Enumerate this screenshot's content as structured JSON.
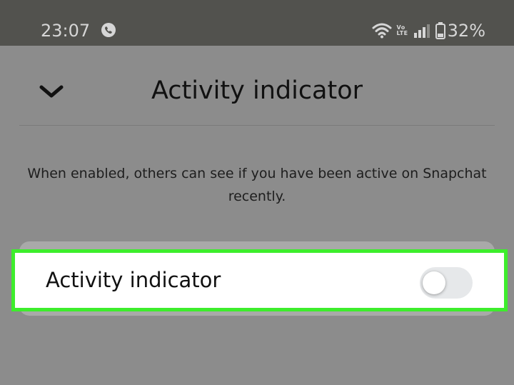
{
  "status_bar": {
    "time": "23:07",
    "call_icon": "phone-call-icon",
    "wifi_icon": "wifi-icon",
    "volte_top": "Vo",
    "volte_bottom": "LTE",
    "signal_icon": "signal-bars-icon",
    "battery_icon": "battery-icon",
    "battery_percent": "32%"
  },
  "header": {
    "back_icon": "chevron-down-icon",
    "title": "Activity indicator"
  },
  "description": "When enabled, others can see if you have been active on Snapchat recently.",
  "setting": {
    "label": "Activity indicator",
    "enabled": false,
    "highlight_color": "#3ded2c"
  },
  "colors": {
    "background_dim": "#8c8c8c",
    "status_bar": "#52524e",
    "card": "#ffffff",
    "toggle_off_track": "#e6e8ea"
  }
}
